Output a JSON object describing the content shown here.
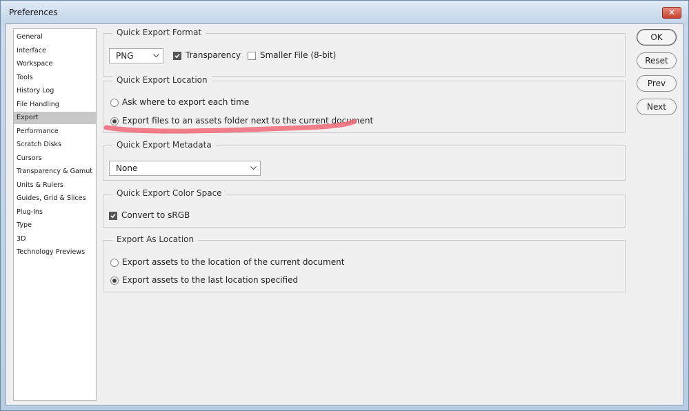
{
  "window": {
    "title": "Preferences",
    "close_glyph": "✕"
  },
  "sidebar": {
    "items": [
      {
        "label": "General"
      },
      {
        "label": "Interface"
      },
      {
        "label": "Workspace"
      },
      {
        "label": "Tools"
      },
      {
        "label": "History Log"
      },
      {
        "label": "File Handling"
      },
      {
        "label": "Export",
        "selected": true
      },
      {
        "label": "Performance"
      },
      {
        "label": "Scratch Disks"
      },
      {
        "label": "Cursors"
      },
      {
        "label": "Transparency & Gamut"
      },
      {
        "label": "Units & Rulers"
      },
      {
        "label": "Guides, Grid & Slices"
      },
      {
        "label": "Plug-Ins"
      },
      {
        "label": "Type"
      },
      {
        "label": "3D"
      },
      {
        "label": "Technology Previews"
      }
    ]
  },
  "quick_export_format": {
    "legend": "Quick Export Format",
    "format_value": "PNG",
    "transparency_label": "Transparency",
    "transparency_checked": true,
    "smaller_file_label": "Smaller File (8-bit)",
    "smaller_file_checked": false
  },
  "quick_export_location": {
    "legend": "Quick Export Location",
    "options": [
      {
        "label": "Ask where to export each time",
        "selected": false
      },
      {
        "label": "Export files to an assets folder next to the current document",
        "selected": true
      }
    ]
  },
  "quick_export_metadata": {
    "legend": "Quick Export Metadata",
    "value": "None"
  },
  "quick_export_color_space": {
    "legend": "Quick Export Color Space",
    "convert_label": "Convert to sRGB",
    "convert_checked": true
  },
  "export_as_location": {
    "legend": "Export As Location",
    "options": [
      {
        "label": "Export assets to the location of the current document",
        "selected": false
      },
      {
        "label": "Export assets to the last location specified",
        "selected": true
      }
    ]
  },
  "buttons": {
    "ok": "OK",
    "reset": "Reset",
    "prev": "Prev",
    "next": "Next"
  },
  "colors": {
    "annotation_highlight": "#f06a78",
    "selected_item_bg": "#c8c8c8",
    "close_button": "#c7422d"
  }
}
